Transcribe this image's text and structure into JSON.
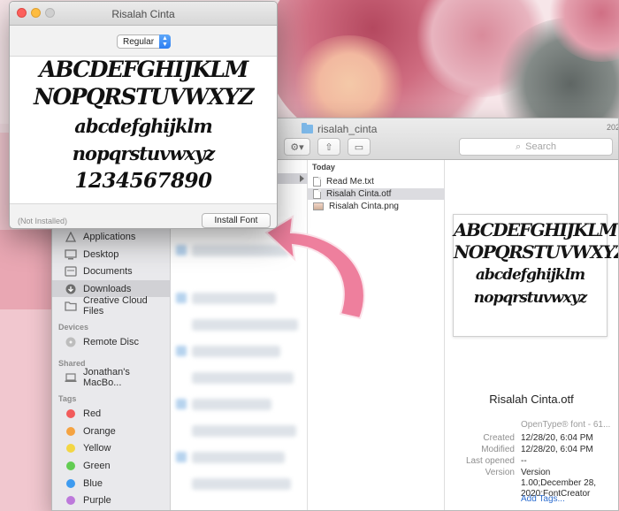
{
  "colors": {
    "arrow": "#ee7f9d",
    "selection": "#d1d1d5",
    "link": "#2f6fd0"
  },
  "font_window": {
    "title": "Risalah Cinta",
    "style_select": "Regular",
    "sample_lines": [
      "ABCDEFGHIJKLM",
      "NOPQRSTUVWXYZ",
      "abcdefghijklm",
      "nopqrstuvwxyz",
      "1234567890"
    ],
    "status": "(Not Installed)",
    "install_button": "Install Font"
  },
  "finder": {
    "title": "risalah_cinta",
    "search_placeholder": "Search",
    "clipped_text": "202",
    "sidebar": {
      "favorites": [
        {
          "label": "Applications",
          "icon": "applications-icon",
          "active": false
        },
        {
          "label": "Desktop",
          "icon": "desktop-icon",
          "active": false
        },
        {
          "label": "Documents",
          "icon": "documents-icon",
          "active": false
        },
        {
          "label": "Downloads",
          "icon": "downloads-icon",
          "active": true
        },
        {
          "label": "Creative Cloud Files",
          "icon": "folder-icon",
          "active": false
        }
      ],
      "devices_header": "Devices",
      "devices": [
        {
          "label": "Remote Disc",
          "icon": "disc-icon"
        }
      ],
      "shared_header": "Shared",
      "shared": [
        {
          "label": "Jonathan's MacBo...",
          "icon": "laptop-icon"
        }
      ],
      "tags_header": "Tags",
      "tags": [
        {
          "label": "Red",
          "color": "#f25b5b"
        },
        {
          "label": "Orange",
          "color": "#f5a341"
        },
        {
          "label": "Yellow",
          "color": "#f3d644"
        },
        {
          "label": "Green",
          "color": "#62cc52"
        },
        {
          "label": "Blue",
          "color": "#3e9bf0"
        },
        {
          "label": "Purple",
          "color": "#bd79db"
        }
      ]
    },
    "column2": {
      "header": "Today",
      "items": [
        {
          "label": "Read Me.txt",
          "type": "text"
        },
        {
          "label": "Risalah Cinta.otf",
          "type": "font",
          "selected": true
        },
        {
          "label": "Risalah Cinta.png",
          "type": "image"
        }
      ]
    },
    "preview": {
      "sample_lines": [
        "ABCDEFGHIJKLM",
        "NOPQRSTUVWXYZ",
        "abcdefghijklm",
        "nopqrstuvwxyz"
      ],
      "name": "Risalah Cinta.otf",
      "kind": "OpenType® font - 61...",
      "created_label": "Created",
      "created": "12/28/20, 6:04 PM",
      "modified_label": "Modified",
      "modified": "12/28/20, 6:04 PM",
      "last_opened_label": "Last opened",
      "last_opened": "--",
      "version_label": "Version",
      "version": "Version 1.00;December 28, 2020;FontCreator",
      "add_tags": "Add Tags..."
    }
  }
}
